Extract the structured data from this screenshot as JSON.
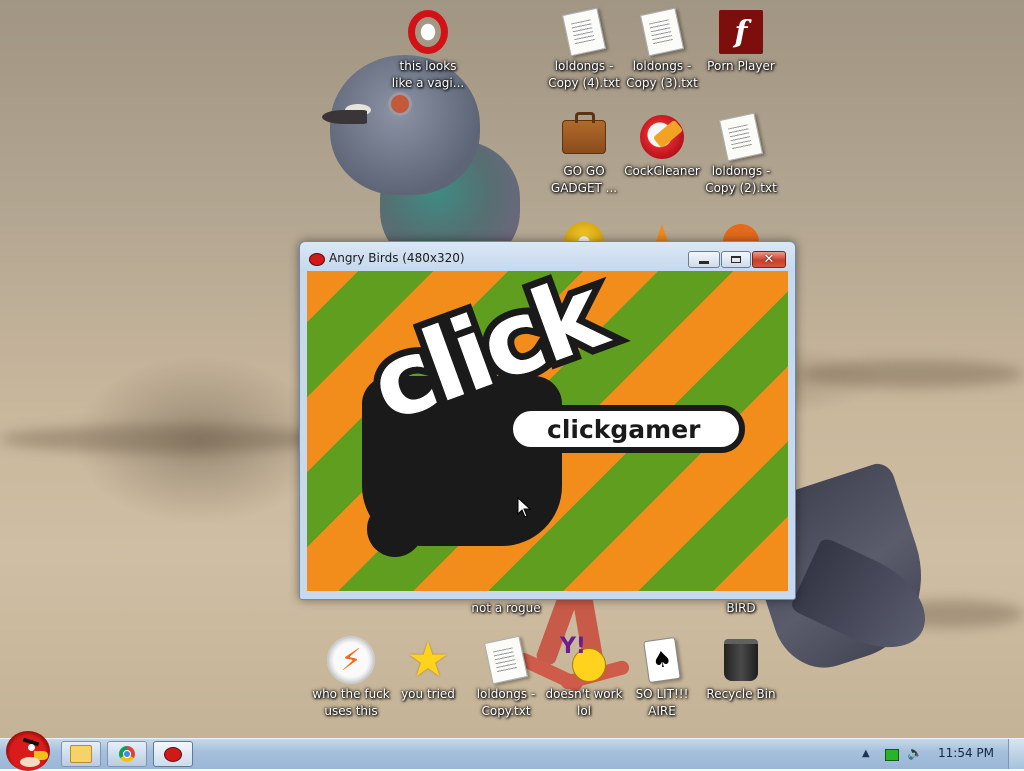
{
  "desktop": {
    "icons": {
      "opera": {
        "label": "this looks like a vagi...",
        "icon": "opera-icon"
      },
      "txt4": {
        "label": "loldongs - Copy (4).txt",
        "icon": "text-file-icon"
      },
      "txt3": {
        "label": "loldongs - Copy (3).txt",
        "icon": "text-file-icon"
      },
      "flash": {
        "label": "Porn Player",
        "icon": "flash-player-icon",
        "glyph": "f"
      },
      "gadget": {
        "label": "GO GO GADGET ...",
        "icon": "briefcase-icon"
      },
      "ccleaner": {
        "label": "CockCleaner",
        "icon": "ccleaner-icon"
      },
      "txt2": {
        "label": "loldongs - Copy (2).txt",
        "icon": "text-file-icon"
      },
      "notrogue": {
        "label": "not a rogue"
      },
      "bird": {
        "label": "BIRD"
      },
      "avast": {
        "label": "who the fuck uses this",
        "icon": "avast-icon"
      },
      "star": {
        "label": "you tried",
        "icon": "star-icon"
      },
      "txtcopy": {
        "label": "loldongs - Copy.txt",
        "icon": "text-file-icon"
      },
      "yahoo": {
        "label": "doesn't work lol",
        "icon": "yahoo-messenger-icon",
        "glyph": "Y!"
      },
      "solitaire": {
        "label": "SO LIT!!! AIRE",
        "icon": "playing-cards-icon"
      },
      "recycle": {
        "label": "Recycle Bin",
        "icon": "recycle-bin-icon"
      }
    }
  },
  "window": {
    "title": "Angry Birds (480x320)",
    "splash": {
      "logo_word": "click",
      "brand": "clickgamer"
    }
  },
  "taskbar": {
    "clock": "11:54 PM",
    "apps": [
      "explorer",
      "chrome",
      "angry-birds"
    ]
  },
  "colors": {
    "stripe_orange": "#f28d1c",
    "stripe_green": "#5f9e1f",
    "close_red": "#c7402a"
  }
}
